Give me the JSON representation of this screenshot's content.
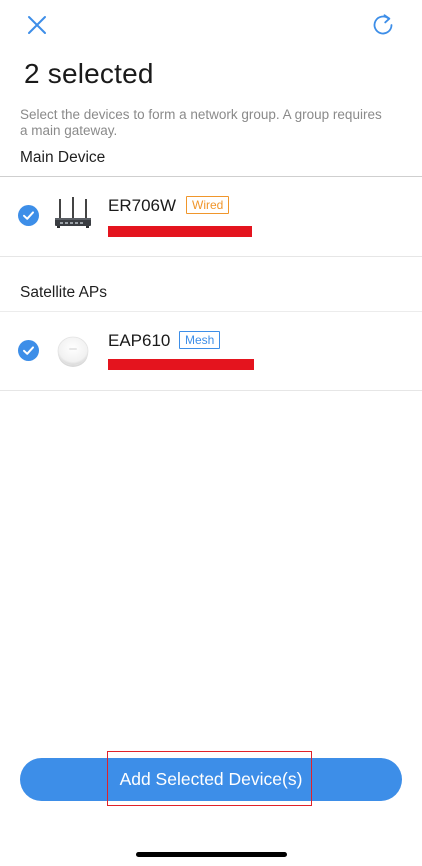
{
  "header": {
    "close_icon": "close-icon",
    "refresh_icon": "refresh-icon"
  },
  "page": {
    "title": "2 selected",
    "description": "Select the devices to form a network group. A group requires a main gateway."
  },
  "sections": {
    "main_device": {
      "label": "Main Device",
      "devices": [
        {
          "name": "ER706W",
          "badge": "Wired",
          "selected": true,
          "image_icon": "router-icon"
        }
      ]
    },
    "satellite_aps": {
      "label": "Satellite APs",
      "devices": [
        {
          "name": "EAP610",
          "badge": "Mesh",
          "selected": true,
          "image_icon": "access-point-icon"
        }
      ]
    }
  },
  "footer": {
    "add_button_label": "Add Selected Device(s)"
  },
  "colors": {
    "accent": "#3d8ee8",
    "wired_badge": "#f0962b",
    "mesh_badge": "#3d8ee8",
    "redaction": "#e4141e",
    "highlight_outline": "#e0222a"
  }
}
